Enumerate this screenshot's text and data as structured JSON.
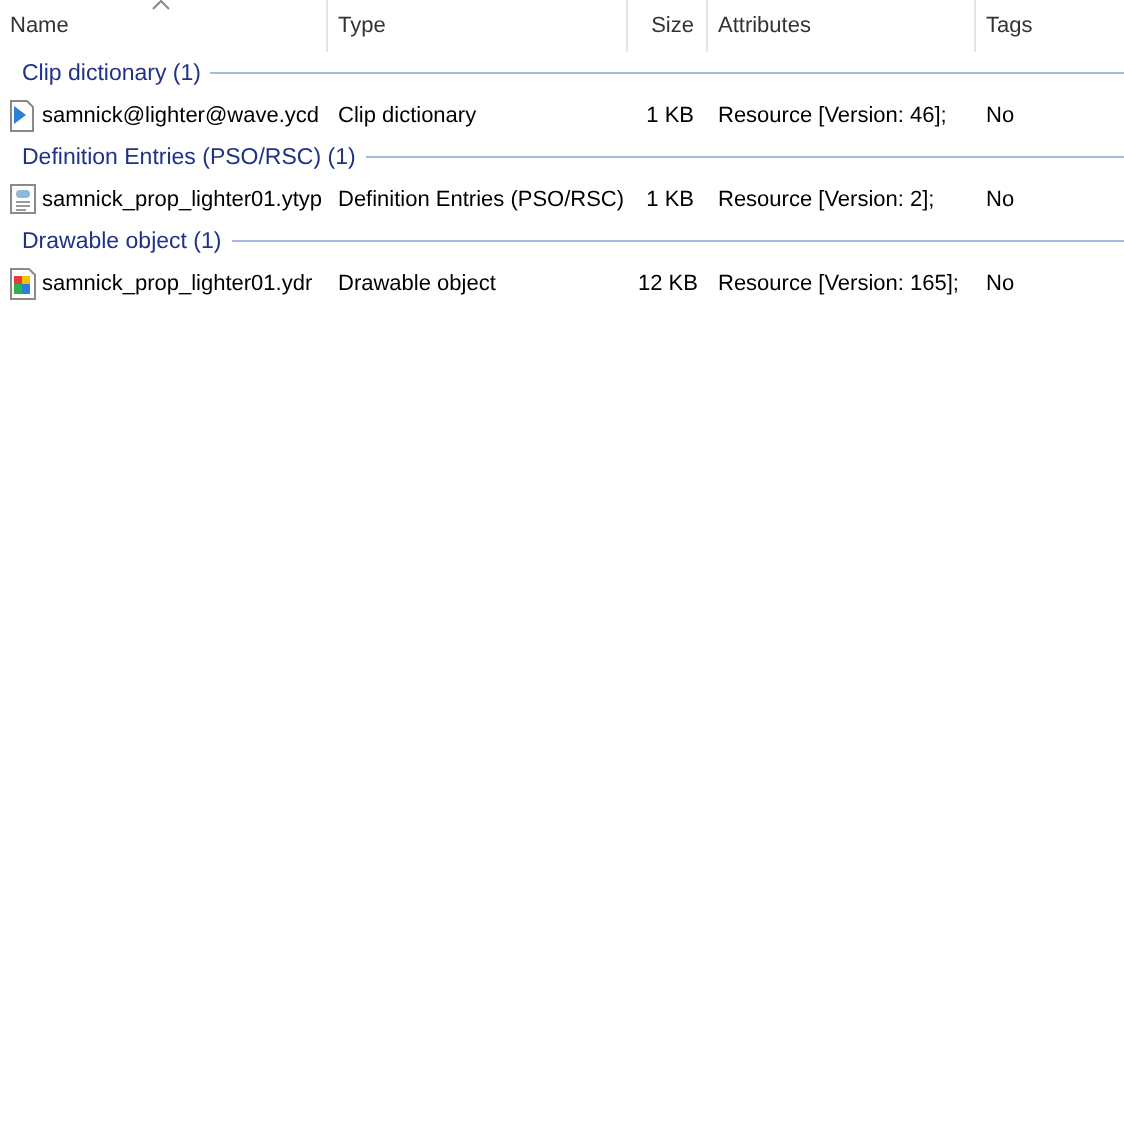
{
  "columns": [
    {
      "label": "Name",
      "sorted": true
    },
    {
      "label": "Type",
      "sorted": false
    },
    {
      "label": "Size",
      "sorted": false
    },
    {
      "label": "Attributes",
      "sorted": false
    },
    {
      "label": "Tags",
      "sorted": false
    }
  ],
  "groups": [
    {
      "title": "Clip dictionary (1)",
      "files": [
        {
          "kind": "clip",
          "name": "samnick@lighter@wave.ycd",
          "type": "Clip dictionary",
          "size": "1 KB",
          "attributes": "Resource [Version: 46];",
          "tags": "No"
        }
      ]
    },
    {
      "title": "Definition Entries (PSO/RSC) (1)",
      "files": [
        {
          "kind": "definition",
          "name": "samnick_prop_lighter01.ytyp",
          "type": "Definition Entries (PSO/RSC)",
          "size": "1 KB",
          "attributes": "Resource [Version: 2];",
          "tags": "No"
        }
      ]
    },
    {
      "title": "Drawable object (1)",
      "files": [
        {
          "kind": "drawable",
          "name": "samnick_prop_lighter01.ydr",
          "type": "Drawable object",
          "size": "12 KB",
          "attributes": "Resource [Version: 165];",
          "tags": "No"
        }
      ]
    }
  ]
}
